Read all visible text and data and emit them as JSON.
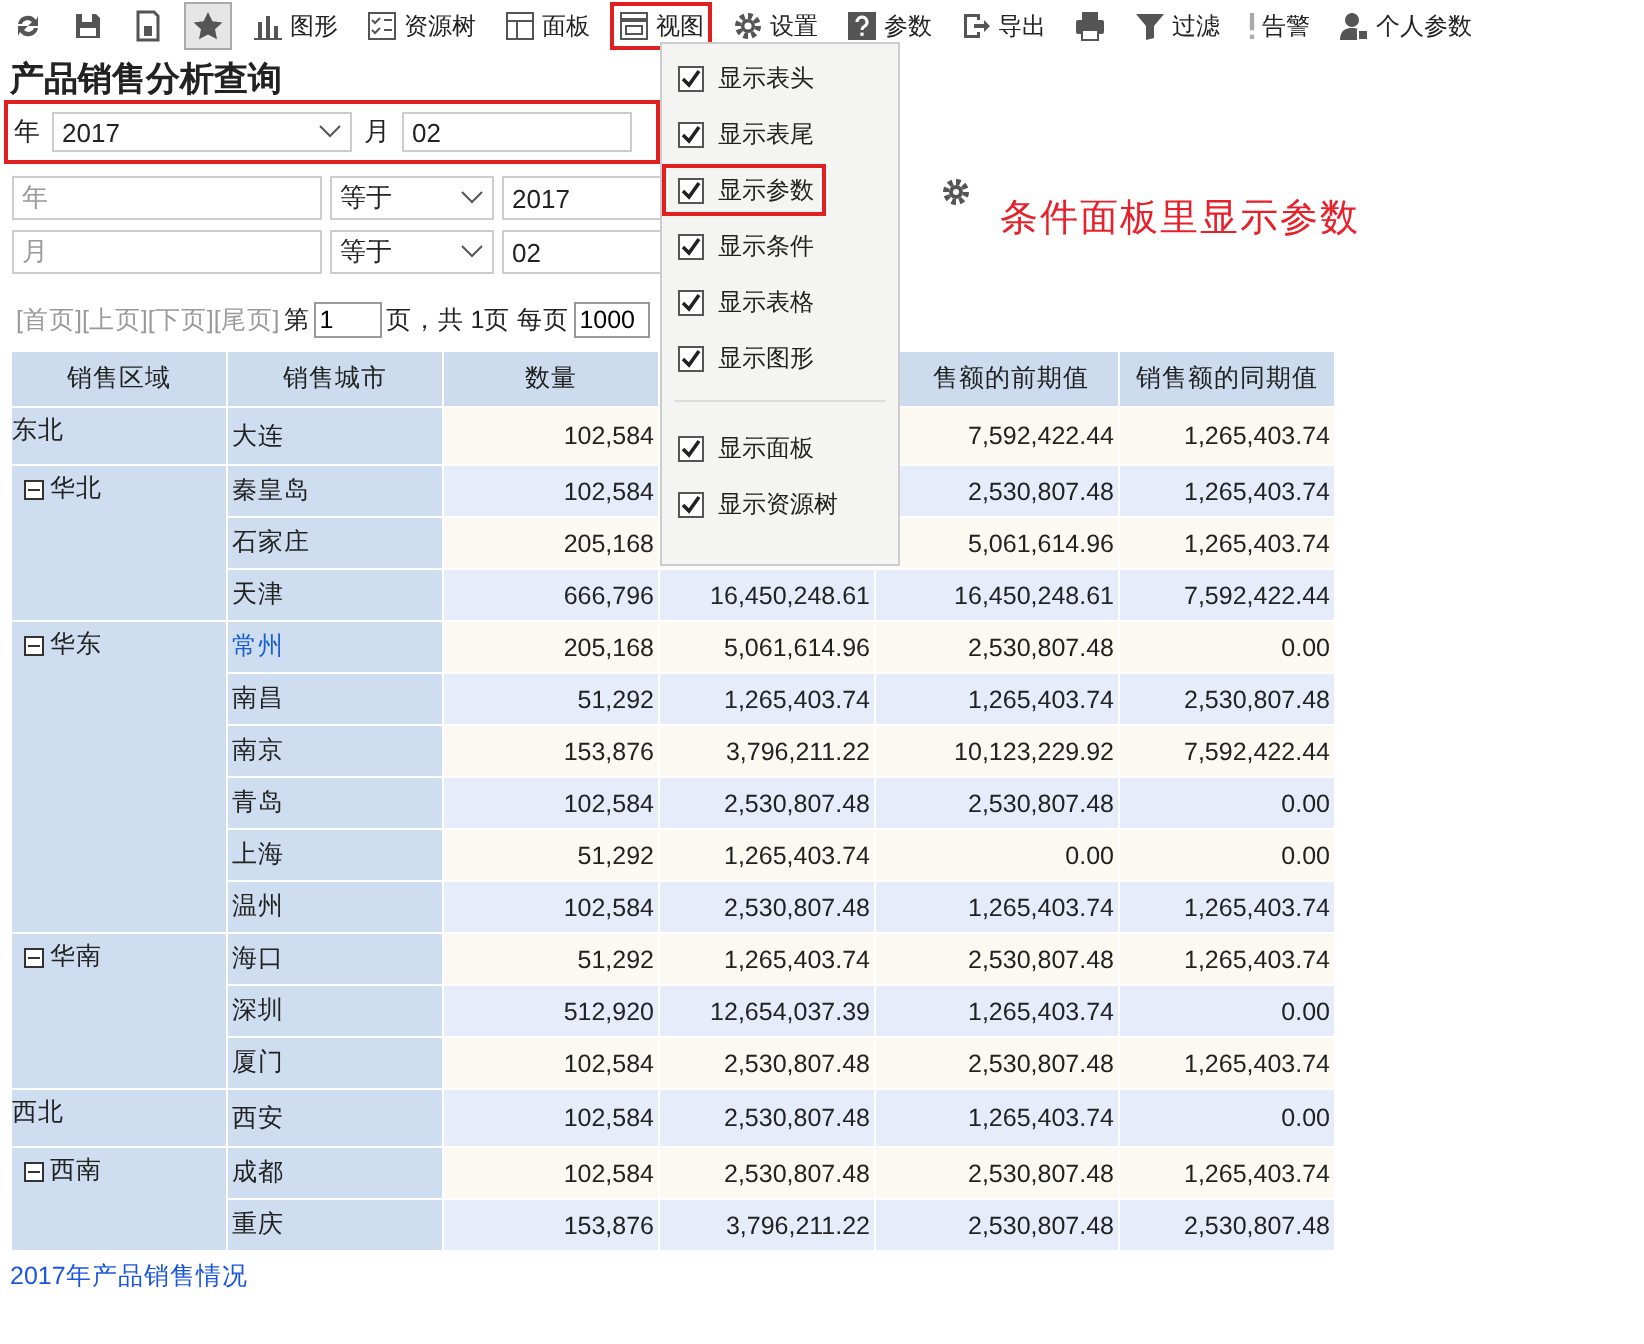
{
  "toolbar": [
    {
      "selected": false,
      "annotated": false
    },
    {
      "selected": false,
      "annotated": false
    },
    {
      "selected": false,
      "annotated": false
    },
    {
      "selected": true,
      "annotated": false
    },
    {
      "label": "图形",
      "selected": false,
      "annotated": false
    },
    {
      "label": "资源树",
      "selected": false,
      "annotated": false
    },
    {
      "label": "面板",
      "selected": false,
      "annotated": false
    },
    {
      "label": "视图",
      "selected": false,
      "annotated": true
    },
    {
      "label": "设置",
      "selected": false,
      "annotated": false
    },
    {
      "label": "参数",
      "selected": false,
      "annotated": false
    },
    {
      "label": "导出",
      "selected": false,
      "annotated": false
    },
    {
      "selected": false,
      "annotated": false
    },
    {
      "label": "过滤",
      "selected": false,
      "annotated": false
    },
    {
      "label": "告警",
      "selected": false,
      "annotated": false
    },
    {
      "label": "个人参数",
      "selected": false,
      "annotated": false
    }
  ],
  "title": "产品销售分析查询",
  "params": {
    "annotated": true,
    "fields": [
      {
        "label": "年",
        "value": "2017",
        "kind": "select"
      },
      {
        "label": "月",
        "value": "02",
        "kind": "input"
      }
    ]
  },
  "conditions": [
    {
      "field": "年",
      "operator": "等于",
      "value": "2017"
    },
    {
      "field": "月",
      "operator": "等于",
      "value": "02"
    }
  ],
  "annotation": {
    "text": "条件面板里显示参数"
  },
  "pager": {
    "nav": "[首页][上页][下页][尾页]",
    "page_prefix": "第",
    "page": "1",
    "page_suffix": "页，共 1页 每页",
    "page_size": "1000"
  },
  "table": {
    "columns": [
      {
        "label": "销售区域"
      },
      {
        "label": "销售城市"
      },
      {
        "label": "数量"
      },
      {},
      {
        "label": "售额的前期值"
      },
      {
        "label": "销售额的同期值"
      }
    ],
    "regions": [
      {
        "name": "东北",
        "kind": "single",
        "cities": [
          {
            "name": "大连",
            "link": false,
            "quantity": "102,584",
            "previous": "7,592,422.44",
            "same_period": "1,265,403.74"
          }
        ]
      },
      {
        "name": "华北",
        "kind": "group",
        "expanded": true,
        "cities": [
          {
            "name": "秦皇岛",
            "link": false,
            "quantity": "102,584",
            "previous": "2,530,807.48",
            "same_period": "1,265,403.74"
          },
          {
            "name": "石家庄",
            "link": false,
            "quantity": "205,168",
            "previous": "5,061,614.96",
            "same_period": "1,265,403.74"
          },
          {
            "name": "天津",
            "link": false,
            "quantity": "666,796",
            "column_4": "16,450,248.61",
            "previous": "16,450,248.61",
            "same_period": "7,592,422.44"
          }
        ]
      },
      {
        "name": "华东",
        "kind": "group",
        "expanded": true,
        "cities": [
          {
            "name": "常州",
            "link": true,
            "quantity": "205,168",
            "column_4": "5,061,614.96",
            "previous": "2,530,807.48",
            "same_period": "0.00"
          },
          {
            "name": "南昌",
            "link": false,
            "quantity": "51,292",
            "column_4": "1,265,403.74",
            "previous": "1,265,403.74",
            "same_period": "2,530,807.48"
          },
          {
            "name": "南京",
            "link": false,
            "quantity": "153,876",
            "column_4": "3,796,211.22",
            "previous": "10,123,229.92",
            "same_period": "7,592,422.44"
          },
          {
            "name": "青岛",
            "link": false,
            "quantity": "102,584",
            "column_4": "2,530,807.48",
            "previous": "2,530,807.48",
            "same_period": "0.00"
          },
          {
            "name": "上海",
            "link": false,
            "quantity": "51,292",
            "column_4": "1,265,403.74",
            "previous": "0.00",
            "same_period": "0.00"
          },
          {
            "name": "温州",
            "link": false,
            "quantity": "102,584",
            "column_4": "2,530,807.48",
            "previous": "1,265,403.74",
            "same_period": "1,265,403.74"
          }
        ]
      },
      {
        "name": "华南",
        "kind": "group",
        "expanded": true,
        "cities": [
          {
            "name": "海口",
            "link": false,
            "quantity": "51,292",
            "column_4": "1,265,403.74",
            "previous": "2,530,807.48",
            "same_period": "1,265,403.74"
          },
          {
            "name": "深圳",
            "link": false,
            "quantity": "512,920",
            "column_4": "12,654,037.39",
            "previous": "1,265,403.74",
            "same_period": "0.00"
          },
          {
            "name": "厦门",
            "link": false,
            "quantity": "102,584",
            "column_4": "2,530,807.48",
            "previous": "2,530,807.48",
            "same_period": "1,265,403.74"
          }
        ]
      },
      {
        "name": "西北",
        "kind": "single",
        "cities": [
          {
            "name": "西安",
            "link": false,
            "quantity": "102,584",
            "column_4": "2,530,807.48",
            "previous": "1,265,403.74",
            "same_period": "0.00"
          }
        ]
      },
      {
        "name": "西南",
        "kind": "group",
        "expanded": true,
        "cities": [
          {
            "name": "成都",
            "link": false,
            "quantity": "102,584",
            "column_4": "2,530,807.48",
            "previous": "2,530,807.48",
            "same_period": "1,265,403.74"
          },
          {
            "name": "重庆",
            "link": false,
            "quantity": "153,876",
            "column_4": "3,796,211.22",
            "previous": "2,530,807.48",
            "same_period": "2,530,807.48"
          }
        ]
      }
    ]
  },
  "footer_link": "2017年产品销售情况",
  "view_menu": {
    "items": [
      {
        "label": "显示表头",
        "checked": true,
        "annotated": false
      },
      {
        "label": "显示表尾",
        "checked": true,
        "annotated": false
      },
      {
        "label": "显示参数",
        "checked": true,
        "annotated": true
      },
      {
        "label": "显示条件",
        "checked": true,
        "annotated": false
      },
      {
        "label": "显示表格",
        "checked": true,
        "annotated": false
      },
      {
        "label": "显示图形",
        "checked": true,
        "annotated": false,
        "separator_after": true
      },
      {
        "label": "显示面板",
        "checked": true,
        "annotated": false
      },
      {
        "label": "显示资源树",
        "checked": true,
        "annotated": false
      }
    ]
  }
}
